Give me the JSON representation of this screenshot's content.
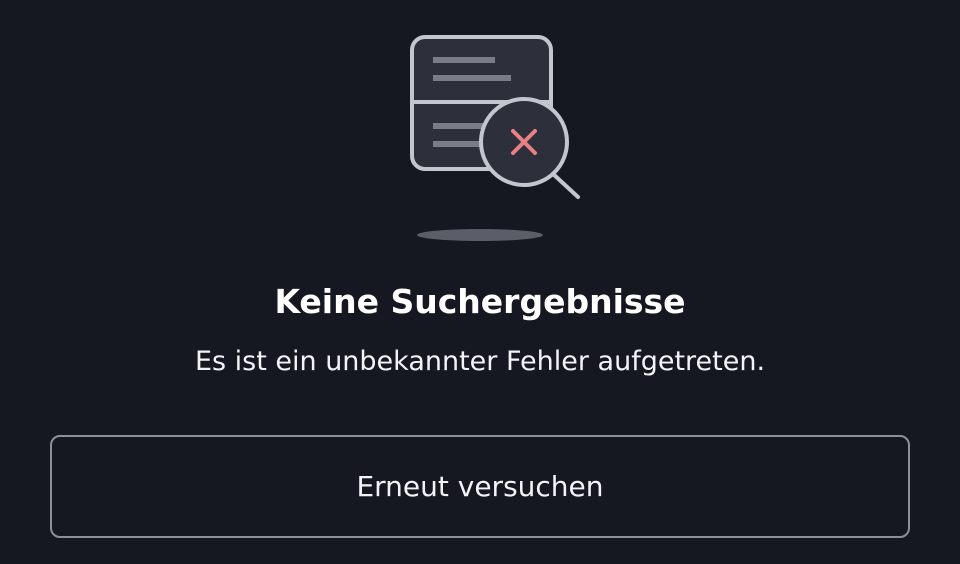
{
  "empty_state": {
    "illustration_icon": "search-no-results-icon",
    "title": "Keine Suchergebnisse",
    "message": "Es ist ein unbekannter Fehler aufgetreten.",
    "retry_label": "Erneut versuchen"
  },
  "colors": {
    "background": "#161821",
    "icon_stroke": "#c4c6cf",
    "icon_fill": "#2d303b",
    "error_mark": "#e98083",
    "button_border": "#8d8f99",
    "text": "#ffffff"
  }
}
